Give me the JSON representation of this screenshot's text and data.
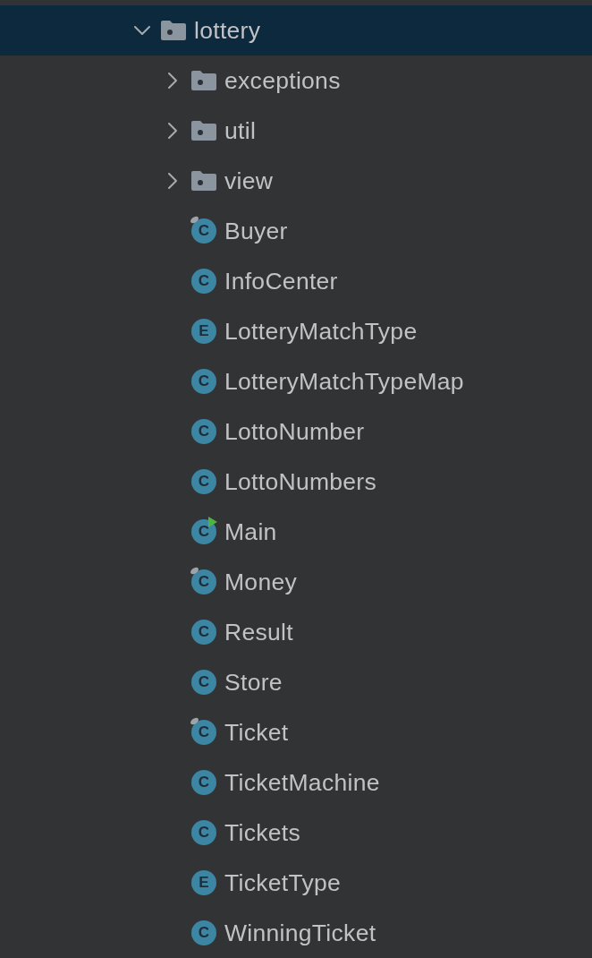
{
  "tree": {
    "name": "lottery",
    "kind": "package",
    "expanded": true,
    "selected": true,
    "children": [
      {
        "name": "exceptions",
        "kind": "package",
        "expanded": false,
        "selected": false
      },
      {
        "name": "util",
        "kind": "package",
        "expanded": false,
        "selected": false
      },
      {
        "name": "view",
        "kind": "package",
        "expanded": false,
        "selected": false
      },
      {
        "name": "Buyer",
        "kind": "class",
        "badge": "C",
        "pinned": true,
        "runnable": false,
        "selected": false
      },
      {
        "name": "InfoCenter",
        "kind": "class",
        "badge": "C",
        "pinned": false,
        "runnable": false,
        "selected": false
      },
      {
        "name": "LotteryMatchType",
        "kind": "enum",
        "badge": "E",
        "pinned": false,
        "runnable": false,
        "selected": false
      },
      {
        "name": "LotteryMatchTypeMap",
        "kind": "class",
        "badge": "C",
        "pinned": false,
        "runnable": false,
        "selected": false
      },
      {
        "name": "LottoNumber",
        "kind": "class",
        "badge": "C",
        "pinned": false,
        "runnable": false,
        "selected": false
      },
      {
        "name": "LottoNumbers",
        "kind": "class",
        "badge": "C",
        "pinned": false,
        "runnable": false,
        "selected": false
      },
      {
        "name": "Main",
        "kind": "class",
        "badge": "C",
        "pinned": false,
        "runnable": true,
        "selected": false
      },
      {
        "name": "Money",
        "kind": "class",
        "badge": "C",
        "pinned": true,
        "runnable": false,
        "selected": false
      },
      {
        "name": "Result",
        "kind": "class",
        "badge": "C",
        "pinned": false,
        "runnable": false,
        "selected": false
      },
      {
        "name": "Store",
        "kind": "class",
        "badge": "C",
        "pinned": false,
        "runnable": false,
        "selected": false
      },
      {
        "name": "Ticket",
        "kind": "class",
        "badge": "C",
        "pinned": true,
        "runnable": false,
        "selected": false
      },
      {
        "name": "TicketMachine",
        "kind": "class",
        "badge": "C",
        "pinned": false,
        "runnable": false,
        "selected": false
      },
      {
        "name": "Tickets",
        "kind": "class",
        "badge": "C",
        "pinned": false,
        "runnable": false,
        "selected": false
      },
      {
        "name": "TicketType",
        "kind": "enum",
        "badge": "E",
        "pinned": false,
        "runnable": false,
        "selected": false
      },
      {
        "name": "WinningTicket",
        "kind": "class",
        "badge": "C",
        "pinned": false,
        "runnable": false,
        "selected": false
      }
    ]
  }
}
